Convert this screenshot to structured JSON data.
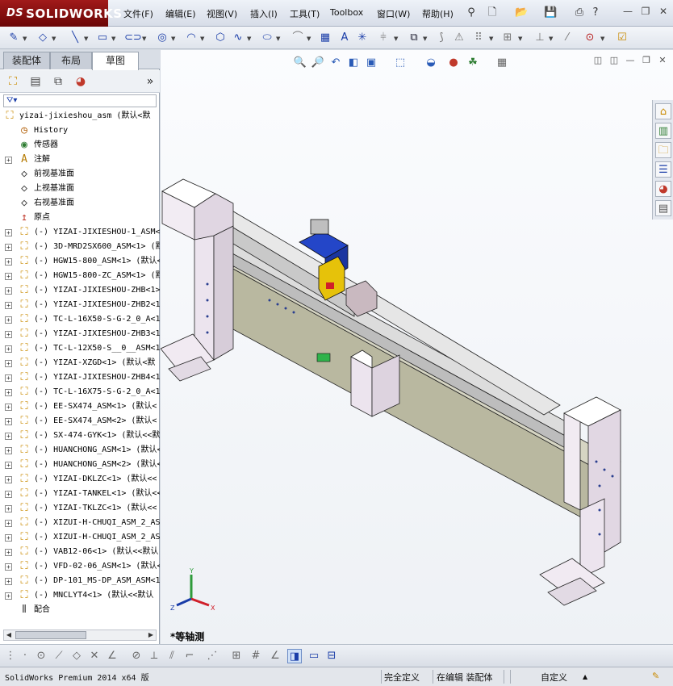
{
  "app": {
    "logo": "SOLIDWORKS",
    "logo_prefix": "DS",
    "brand_color": "#8b0d0d"
  },
  "menu": [
    "文件(F)",
    "编辑(E)",
    "视图(V)",
    "插入(I)",
    "工具(T)",
    "Toolbox",
    "窗口(W)",
    "帮助(H)"
  ],
  "panel": {
    "tabs": [
      "装配体",
      "布局",
      "草图"
    ],
    "active_tab": "草图",
    "root": "yizai-jixieshou_asm  (默认<默",
    "items": [
      {
        "label": "History",
        "icon": "history-icon"
      },
      {
        "label": "传感器",
        "icon": "sensor-icon"
      },
      {
        "label": "注解",
        "icon": "annotation-icon",
        "expand": "+"
      },
      {
        "label": "前视基准面",
        "icon": "plane-icon"
      },
      {
        "label": "上视基准面",
        "icon": "plane-icon"
      },
      {
        "label": "右视基准面",
        "icon": "plane-icon"
      },
      {
        "label": "原点",
        "icon": "origin-icon"
      },
      {
        "label": "(-) YIZAI-JIXIESHOU-1_ASM<",
        "icon": "component-icon",
        "expand": "+"
      },
      {
        "label": "(-) 3D-MRD2SX600_ASM<1> (默",
        "icon": "component-icon",
        "expand": "+"
      },
      {
        "label": "(-) HGW15-800_ASM<1> (默认<",
        "icon": "component-icon",
        "expand": "+"
      },
      {
        "label": "(-) HGW15-800-ZC_ASM<1> (默",
        "icon": "component-icon",
        "expand": "+"
      },
      {
        "label": "(-) YIZAI-JIXIESHOU-ZHB<1>",
        "icon": "component-icon",
        "expand": "+"
      },
      {
        "label": "(-) YIZAI-JIXIESHOU-ZHB2<1",
        "icon": "component-icon",
        "expand": "+"
      },
      {
        "label": "(-) TC-L-16X50-S-G-2_0_A<1",
        "icon": "component-icon",
        "expand": "+"
      },
      {
        "label": "(-) YIZAI-JIXIESHOU-ZHB3<1",
        "icon": "component-icon",
        "expand": "+"
      },
      {
        "label": "(-) TC-L-12X50-S__0__ASM<1",
        "icon": "component-icon",
        "expand": "+"
      },
      {
        "label": "(-) YIZAI-XZGD<1> (默认<默",
        "icon": "component-icon",
        "expand": "+"
      },
      {
        "label": "(-) YIZAI-JIXIESHOU-ZHB4<1",
        "icon": "component-icon",
        "expand": "+"
      },
      {
        "label": "(-) TC-L-16X75-S-G-2_0_A<1",
        "icon": "component-icon",
        "expand": "+"
      },
      {
        "label": "(-) EE-SX474_ASM<1> (默认<",
        "icon": "component-icon",
        "expand": "+"
      },
      {
        "label": "(-) EE-SX474_ASM<2> (默认<",
        "icon": "component-icon",
        "expand": "+"
      },
      {
        "label": "(-) SX-474-GYK<1> (默认<<默",
        "icon": "component-icon",
        "expand": "+"
      },
      {
        "label": "(-) HUANCHONG_ASM<1> (默认<",
        "icon": "component-icon",
        "expand": "+"
      },
      {
        "label": "(-) HUANCHONG_ASM<2> (默认<",
        "icon": "component-icon",
        "expand": "+"
      },
      {
        "label": "(-) YIZAI-DKLZC<1> (默认<<",
        "icon": "component-icon",
        "expand": "+"
      },
      {
        "label": "(-) YIZAI-TANKEL<1> (默认<<",
        "icon": "component-icon",
        "expand": "+"
      },
      {
        "label": "(-) YIZAI-TKLZC<1> (默认<<",
        "icon": "component-icon",
        "expand": "+"
      },
      {
        "label": "(-) XIZUI-H-CHUQI_ASM_2_AS",
        "icon": "component-icon",
        "expand": "+"
      },
      {
        "label": "(-) XIZUI-H-CHUQI_ASM_2_AS",
        "icon": "component-icon",
        "expand": "+"
      },
      {
        "label": "(-) VAB12-06<1> (默认<<默认",
        "icon": "component-icon",
        "expand": "+"
      },
      {
        "label": "(-) VFD-02-06_ASM<1> (默认<",
        "icon": "component-icon",
        "expand": "+"
      },
      {
        "label": "(-) DP-101_MS-DP_ASM_ASM<1",
        "icon": "component-icon",
        "expand": "+"
      },
      {
        "label": "(-) MNCLYT4<1> (默认<<默认",
        "icon": "component-icon",
        "expand": "+"
      },
      {
        "label": "配合",
        "icon": "mate-icon"
      }
    ]
  },
  "viewport": {
    "view_name": "*等轴测",
    "triad": {
      "x": "X",
      "y": "Y",
      "z": "Z"
    }
  },
  "status": {
    "product": "SolidWorks Premium 2014 x64 版",
    "definition": "完全定义",
    "mode": "在编辑 装配体",
    "units": "自定义",
    "units_arrow": "▲"
  }
}
